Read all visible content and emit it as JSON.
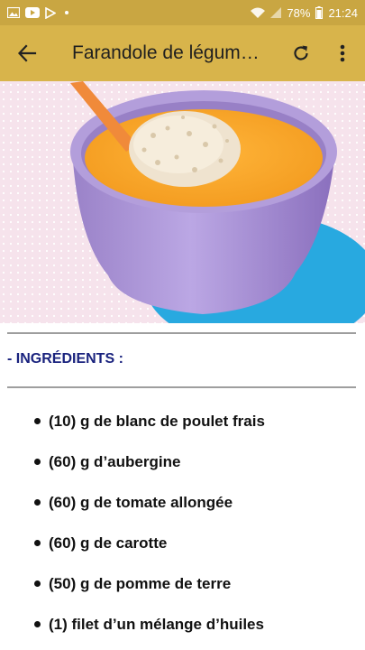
{
  "status_bar": {
    "battery": "78%",
    "time": "21:24",
    "icons": [
      "image-icon",
      "youtube-icon",
      "play-store-icon",
      "wifi-icon",
      "signal-icon",
      "battery-icon"
    ]
  },
  "toolbar": {
    "title": "Farandole de légum…",
    "back_icon": "arrow-left-icon",
    "refresh_icon": "refresh-icon",
    "more_icon": "more-vert-icon"
  },
  "section": {
    "heading": "- INGRÉDIENTS :"
  },
  "ingredients": [
    "(10) g de blanc de poulet frais",
    "(60) g d’aubergine",
    "(60) g de tomate allongée",
    "(60) g de carotte",
    "(50) g de pomme de terre",
    "(1) filet d’un mélange d’huiles"
  ],
  "colors": {
    "status_bar": "#c9a642",
    "toolbar": "#d8b44b",
    "heading": "#1a237e"
  }
}
